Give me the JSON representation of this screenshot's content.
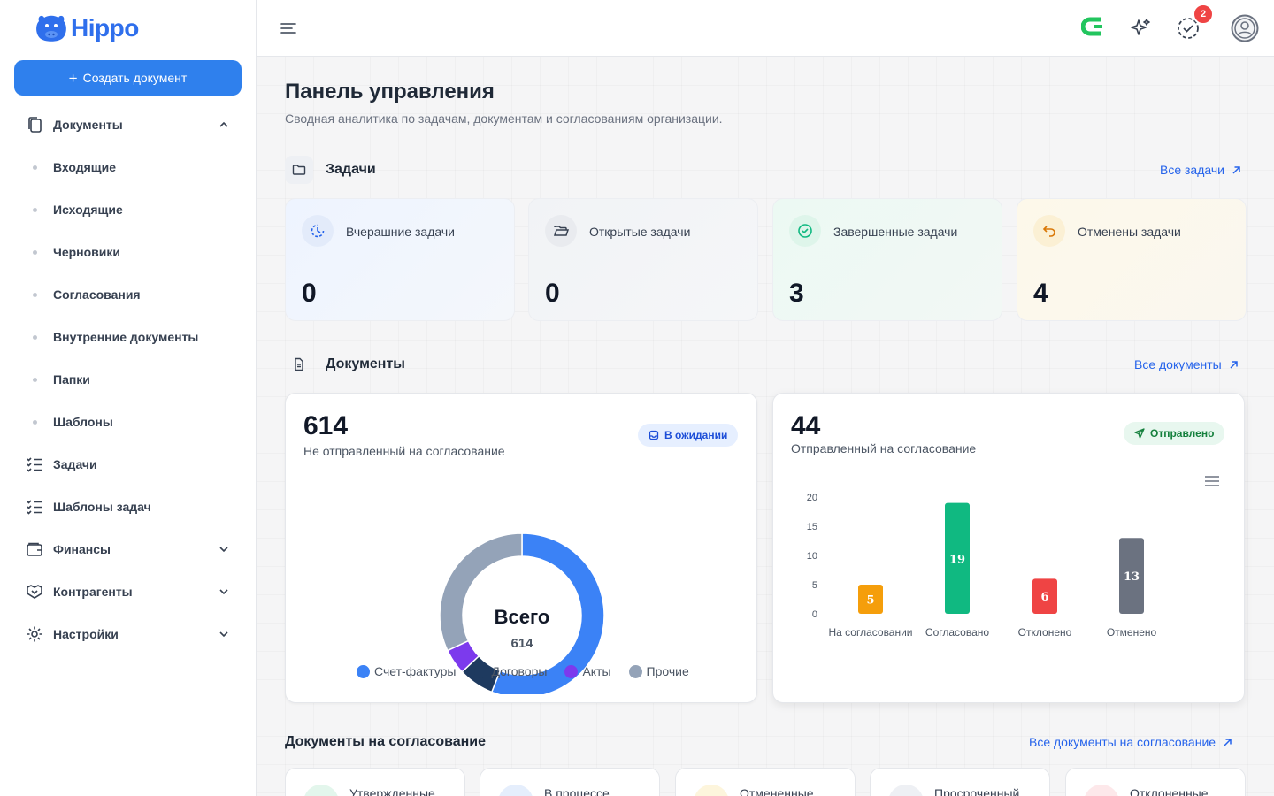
{
  "brand": {
    "name": "Hippo",
    "color": "#2f6fec"
  },
  "sidebar": {
    "create_label": "Создать документ",
    "nav": [
      {
        "label": "Документы",
        "icon": "documents-icon",
        "expanded": true
      },
      {
        "label": "Входящие"
      },
      {
        "label": "Исходящие"
      },
      {
        "label": "Черновики"
      },
      {
        "label": "Согласования"
      },
      {
        "label": "Внутренние документы"
      },
      {
        "label": "Папки"
      },
      {
        "label": "Шаблоны"
      },
      {
        "label": "Задачи",
        "icon": "tasks-icon"
      },
      {
        "label": "Шаблоны задач",
        "icon": "task-templates-icon"
      },
      {
        "label": "Финансы",
        "icon": "wallet-icon",
        "expanded": false
      },
      {
        "label": "Контрагенты",
        "icon": "handshake-icon",
        "expanded": false
      },
      {
        "label": "Настройки",
        "icon": "gear-icon",
        "expanded": false
      }
    ]
  },
  "topbar": {
    "notification_count": "2"
  },
  "page": {
    "title": "Панель управления",
    "subtitle": "Сводная аналитика по задачам, документам и согласованиям организации."
  },
  "tasks": {
    "title": "Задачи",
    "link": "Все задачи",
    "cards": [
      {
        "label": "Вчерашние задачи",
        "value": "0",
        "icon": "clock-icon",
        "color": "#2563eb"
      },
      {
        "label": "Открытые задачи",
        "value": "0",
        "icon": "folder-open-icon",
        "color": "#374151"
      },
      {
        "label": "Завершенные задачи",
        "value": "3",
        "icon": "check-circle-icon",
        "color": "#10b981"
      },
      {
        "label": "Отменены задачи",
        "value": "4",
        "icon": "undo-icon",
        "color": "#f59e0b"
      }
    ]
  },
  "documents": {
    "title": "Документы",
    "link": "Все документы",
    "pending": {
      "value": "614",
      "caption": "Не отправленный на согласование",
      "status": "В ожидании",
      "center_title": "Всего",
      "center_value": "614"
    },
    "sent": {
      "value": "44",
      "caption": "Отправленный на согласование",
      "status": "Отправлено"
    }
  },
  "approvals": {
    "title": "Документы на согласование",
    "link": "Все документы на согласование",
    "cards": [
      {
        "label": "Утвержденные"
      },
      {
        "label": "В процессе"
      },
      {
        "label": "Отмененные"
      },
      {
        "label": "Просроченный"
      },
      {
        "label": "Отклоненные"
      }
    ]
  },
  "chart_data": [
    {
      "type": "pie",
      "variant": "donut",
      "categories": [
        "Счет-фактуры",
        "Договоры",
        "Акты",
        "Прочие"
      ],
      "values": [
        0.56,
        0.07,
        0.05,
        0.32
      ],
      "unit": "share",
      "colors": [
        "#3b82f6",
        "#1e3a5f",
        "#7c3aed",
        "#94a3b8"
      ],
      "legend": "bottom"
    },
    {
      "type": "bar",
      "categories": [
        "На согласовании",
        "Согласовано",
        "Отклонено",
        "Отменено"
      ],
      "values": [
        5,
        19,
        6,
        13
      ],
      "colors": [
        "#f59e0b",
        "#10b981",
        "#ef4444",
        "#6b7280"
      ],
      "yticks": [
        "0",
        "5",
        "10",
        "15",
        "20"
      ],
      "ylim": [
        0,
        20
      ],
      "grid": false,
      "data_labels": true
    }
  ]
}
